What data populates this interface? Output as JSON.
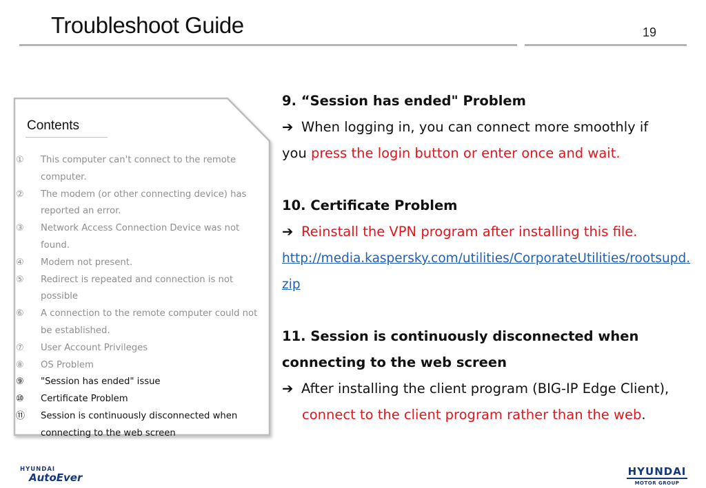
{
  "header": {
    "title": "Troubleshoot Guide",
    "page_number": "19"
  },
  "toc": {
    "heading": "Contents",
    "items": [
      {
        "num": "①",
        "text": "This computer can't connect to the remote\ncomputer.",
        "active": false
      },
      {
        "num": "②",
        "text": "The modem (or other connecting device) has\nreported an error.",
        "active": false
      },
      {
        "num": "③",
        "text": "Network Access Connection Device was not found.",
        "active": false
      },
      {
        "num": "④",
        "text": "Modem not present.",
        "active": false
      },
      {
        "num": "⑤",
        "text": "Redirect is repeated and connection is not\npossible",
        "active": false
      },
      {
        "num": "⑥",
        "text": "A connection to the remote computer could not\nbe established.",
        "active": false
      },
      {
        "num": "⑦",
        "text": "User Account Privileges",
        "active": false
      },
      {
        "num": "⑧",
        "text": "OS Problem",
        "active": false
      },
      {
        "num": "⑨",
        "text": "\"Session has ended\" issue",
        "active": true
      },
      {
        "num": "⑩",
        "text": "Certificate Problem",
        "active": true
      },
      {
        "num": "⑪",
        "text": "Session is continuously disconnected when\nconnecting to the web screen",
        "active": true
      }
    ]
  },
  "sections": {
    "s9": {
      "heading": "9. “Session has ended\" Problem",
      "arrow": "➔",
      "line1": "When logging in, you can connect more smoothly if",
      "line2_plain": "you ",
      "line2_red": "press the login button or enter once and wait."
    },
    "s10": {
      "heading": "10. Certificate Problem",
      "arrow": "➔",
      "red": "Reinstall the VPN program after installing this file.",
      "link_line1": "http://media.kaspersky.com/utilities/CorporateUtilities/rootsupd.",
      "link_line2": "zip"
    },
    "s11": {
      "heading_line1": "11. Session is continuously disconnected when",
      "heading_line2": "connecting to the web screen",
      "arrow": "➔",
      "line1": "After installing the client program (BIG-IP Edge Client),",
      "line2_red": "connect to the client program rather than the web",
      "line2_end": "."
    }
  },
  "footer": {
    "left_logo_top": "HYUNDAI",
    "left_logo_bottom": "AutoEver",
    "right_logo_top": "HYUNDAI",
    "right_logo_bottom": "MOTOR GROUP"
  },
  "colors": {
    "accent_red": "#e3141b",
    "link_blue": "#1f5fb8",
    "brand_navy": "#14377d"
  }
}
